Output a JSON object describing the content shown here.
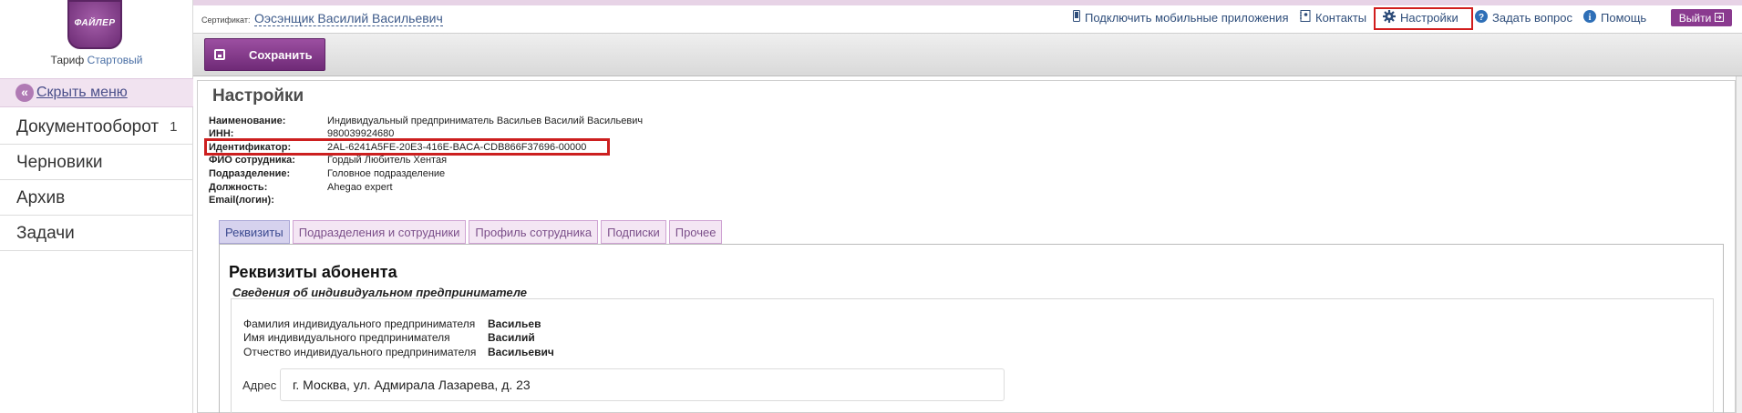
{
  "sidebar": {
    "logo_text": "ФАЙЛЕР",
    "tariff_label": "Тариф",
    "tariff_value": "Стартовый",
    "hide_menu": "Скрыть меню",
    "items": [
      {
        "label": "Документооборот",
        "count": "1"
      },
      {
        "label": "Черновики"
      },
      {
        "label": "Архив"
      },
      {
        "label": "Задачи"
      }
    ]
  },
  "header": {
    "cert_label": "Сертификат:",
    "cert_owner": "Оэсэнщик Василий Васильевич",
    "links": {
      "mobile": "Подключить мобильные приложения",
      "contacts": "Контакты",
      "settings": "Настройки",
      "ask": "Задать вопрос",
      "help": "Помощь",
      "exit": "Выйти"
    }
  },
  "toolbar": {
    "save_label": "Сохранить"
  },
  "page": {
    "title": "Настройки",
    "info": [
      {
        "key": "Наименование:",
        "value": "Индивидуальный предприниматель Васильев Василий Васильевич"
      },
      {
        "key": "ИНН:",
        "value": "980039924680"
      },
      {
        "key": "Идентификатор:",
        "value": "2AL-6241A5FE-20E3-416E-BACA-CDB866F37696-00000"
      },
      {
        "key": "ФИО сотрудника:",
        "value": "Гордый Любитель Хентая"
      },
      {
        "key": "Подразделение:",
        "value": "Головное подразделение"
      },
      {
        "key": "Должность:",
        "value": "Ahegao expert"
      },
      {
        "key": "Email(логин):",
        "value": ""
      }
    ],
    "tabs": [
      "Реквизиты",
      "Подразделения и сотрудники",
      "Профиль сотрудника",
      "Подписки",
      "Прочее"
    ],
    "active_tab": 0
  },
  "requisites": {
    "title": "Реквизиты абонента",
    "subtitle": "Сведения об индивидуальном предпринимателе",
    "fields": [
      {
        "label": "Фамилия индивидуального предпринимателя",
        "value": "Васильев"
      },
      {
        "label": "Имя индивидуального предпринимателя",
        "value": "Василий"
      },
      {
        "label": "Отчество индивидуального предпринимателя",
        "value": "Васильевич"
      }
    ],
    "address_label": "Адрес",
    "address_value": "г. Москва, ул. Адмирала Лазарева, д. 23"
  },
  "colors": {
    "accent": "#8a3a8f",
    "highlight_box": "#d11d1d"
  }
}
